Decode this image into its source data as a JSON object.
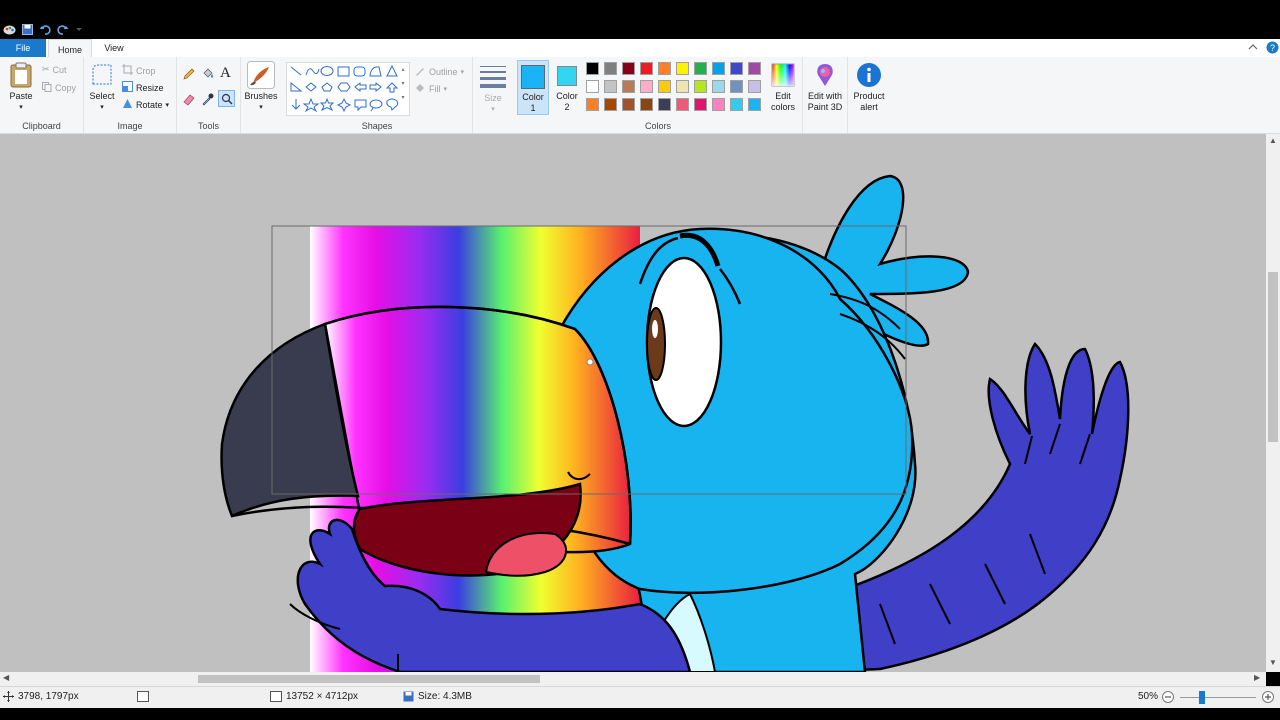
{
  "ribbon": {
    "tabs": {
      "file": "File",
      "home": "Home",
      "view": "View"
    },
    "clipboard": {
      "label": "Clipboard",
      "paste": "Paste",
      "cut": "Cut",
      "copy": "Copy"
    },
    "image": {
      "label": "Image",
      "select": "Select",
      "crop": "Crop",
      "resize": "Resize",
      "rotate": "Rotate"
    },
    "tools": {
      "label": "Tools"
    },
    "brushes": {
      "label": "Brushes"
    },
    "shapes": {
      "label": "Shapes",
      "outline": "Outline",
      "fill": "Fill"
    },
    "size": {
      "label": "Size"
    },
    "colors": {
      "label": "Colors",
      "color1": "Color\n1",
      "color2": "Color\n2",
      "color1_value": "#1ab3f5",
      "color2_value": "#33d6f0",
      "edit_colors": "Edit\ncolors",
      "edit_paint3d": "Edit with\nPaint 3D",
      "product_alert": "Product\nalert",
      "palette_row1": [
        "#000000",
        "#7f7f7f",
        "#880015",
        "#ed1c24",
        "#ff7f27",
        "#fff200",
        "#22b14c",
        "#00a2e8",
        "#3f48cc",
        "#a349a4"
      ],
      "palette_row2": [
        "#ffffff",
        "#c3c3c3",
        "#b97a57",
        "#ffaec9",
        "#ffc90e",
        "#efe4b0",
        "#b5e61d",
        "#99d9ea",
        "#7092be",
        "#c8bfe7"
      ],
      "palette_row3": [
        "#ff7f27",
        "#a34a00",
        "#a0522d",
        "#8b4513",
        "#3a3f55",
        "#f05a78",
        "#e0166e",
        "#ff80c0",
        "#33ccee",
        "#1ab3f5"
      ]
    }
  },
  "status": {
    "cursor": "3798, 1797px",
    "dimensions": "13752 × 4712px",
    "size": "Size: 4.3MB",
    "zoom": "50%"
  }
}
